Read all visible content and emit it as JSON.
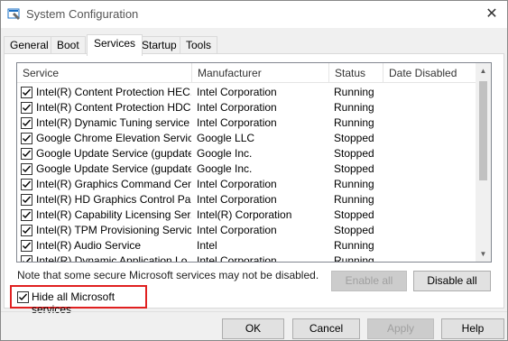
{
  "window": {
    "title": "System Configuration",
    "close_glyph": "✕"
  },
  "tabs": [
    "General",
    "Boot",
    "Services",
    "Startup",
    "Tools"
  ],
  "active_tab": "Services",
  "columns": {
    "service": "Service",
    "manufacturer": "Manufacturer",
    "status": "Status",
    "date_disabled": "Date Disabled"
  },
  "rows": [
    {
      "service": "Intel(R) Content Protection HEC...",
      "manufacturer": "Intel Corporation",
      "status": "Running",
      "date_disabled": "",
      "checked": true
    },
    {
      "service": "Intel(R) Content Protection HDC...",
      "manufacturer": "Intel Corporation",
      "status": "Running",
      "date_disabled": "",
      "checked": true
    },
    {
      "service": "Intel(R) Dynamic Tuning service",
      "manufacturer": "Intel Corporation",
      "status": "Running",
      "date_disabled": "",
      "checked": true
    },
    {
      "service": "Google Chrome Elevation Servic...",
      "manufacturer": "Google LLC",
      "status": "Stopped",
      "date_disabled": "",
      "checked": true
    },
    {
      "service": "Google Update Service (gupdate)",
      "manufacturer": "Google Inc.",
      "status": "Stopped",
      "date_disabled": "",
      "checked": true
    },
    {
      "service": "Google Update Service (gupdatem)",
      "manufacturer": "Google Inc.",
      "status": "Stopped",
      "date_disabled": "",
      "checked": true
    },
    {
      "service": "Intel(R) Graphics Command Cen...",
      "manufacturer": "Intel Corporation",
      "status": "Running",
      "date_disabled": "",
      "checked": true
    },
    {
      "service": "Intel(R) HD Graphics Control Pa...",
      "manufacturer": "Intel Corporation",
      "status": "Running",
      "date_disabled": "",
      "checked": true
    },
    {
      "service": "Intel(R) Capability Licensing Ser...",
      "manufacturer": "Intel(R) Corporation",
      "status": "Stopped",
      "date_disabled": "",
      "checked": true
    },
    {
      "service": "Intel(R) TPM Provisioning Service",
      "manufacturer": "Intel Corporation",
      "status": "Stopped",
      "date_disabled": "",
      "checked": true
    },
    {
      "service": "Intel(R) Audio Service",
      "manufacturer": "Intel",
      "status": "Running",
      "date_disabled": "",
      "checked": true
    },
    {
      "service": "Intel(R) Dynamic Application Lo...",
      "manufacturer": "Intel Corporation",
      "status": "Running",
      "date_disabled": "",
      "checked": true
    }
  ],
  "note": "Note that some secure Microsoft services may not be disabled.",
  "buttons": {
    "enable_all": "Enable all",
    "disable_all": "Disable all",
    "ok": "OK",
    "cancel": "Cancel",
    "apply": "Apply",
    "help": "Help"
  },
  "hide_ms": {
    "label": "Hide all Microsoft services",
    "checked": true
  },
  "colors": {
    "highlight_border": "#e02020",
    "panel_bg": "#ffffff",
    "window_bg": "#f0f0f0"
  }
}
